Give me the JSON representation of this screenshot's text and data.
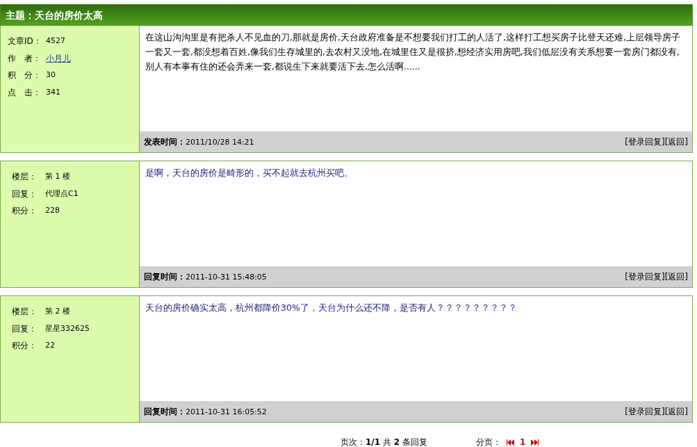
{
  "topic": {
    "title": "主题：天台的房价太高"
  },
  "posts": [
    {
      "kind": "article",
      "meta": [
        {
          "label": "文章ID：",
          "value": "4527",
          "link": false
        },
        {
          "label": "作　者：",
          "value": "小月儿",
          "link": true
        },
        {
          "label": "积　分：",
          "value": "30",
          "link": false
        },
        {
          "label": "点　击：",
          "value": "341",
          "link": false
        }
      ],
      "content": "在这山沟沟里是有把杀人不见血的刀,那就是房价,天台政府准备是不想要我们打工的人活了,这样打工想买房子比登天还难,上层领导房子一套又一套,都没想着百姓,像我们生存城里的,去农村又没地,在城里住又是很挤,想经济实用房吧,我们低层没有关系想要一套房门都没有,别人有本事有住的还会弄来一套,都说生下来就要活下去,怎么活啊......",
      "footer_label": "发表时间：",
      "footer_time": "2011/10/28 14:21",
      "actions": [
        "[登录回复]",
        "[返回]"
      ]
    },
    {
      "kind": "reply",
      "meta": [
        {
          "label": "楼层：",
          "value": "第 1 楼",
          "link": false
        },
        {
          "label": "回复：",
          "value": "代理点C1",
          "link": false
        },
        {
          "label": "积分：",
          "value": "228",
          "link": false
        }
      ],
      "content": "是啊，天台的房价是畸形的，买不起就去杭州买吧。",
      "footer_label": "回复时间：",
      "footer_time": "2011-10-31 15:48:05",
      "actions": [
        "[登录回复]",
        "[返回]"
      ]
    },
    {
      "kind": "reply",
      "meta": [
        {
          "label": "楼层：",
          "value": "第 2 楼",
          "link": false
        },
        {
          "label": "回复：",
          "value": "星星332625",
          "link": false
        },
        {
          "label": "积分：",
          "value": "22",
          "link": false
        }
      ],
      "content": "天台的房价确实太高，杭州都降价30%了，天台为什么还不降，是否有人？？？？？？？？？",
      "footer_label": "回复时间：",
      "footer_time": "2011-10-31 16:05:52",
      "actions": [
        "[登录回复]",
        "[返回]"
      ]
    }
  ],
  "pager": {
    "summary": "页次：**1/1** 共 **2** 条回复",
    "label": "分页：",
    "pages": [
      {
        "label": "1",
        "selected": true
      }
    ]
  }
}
